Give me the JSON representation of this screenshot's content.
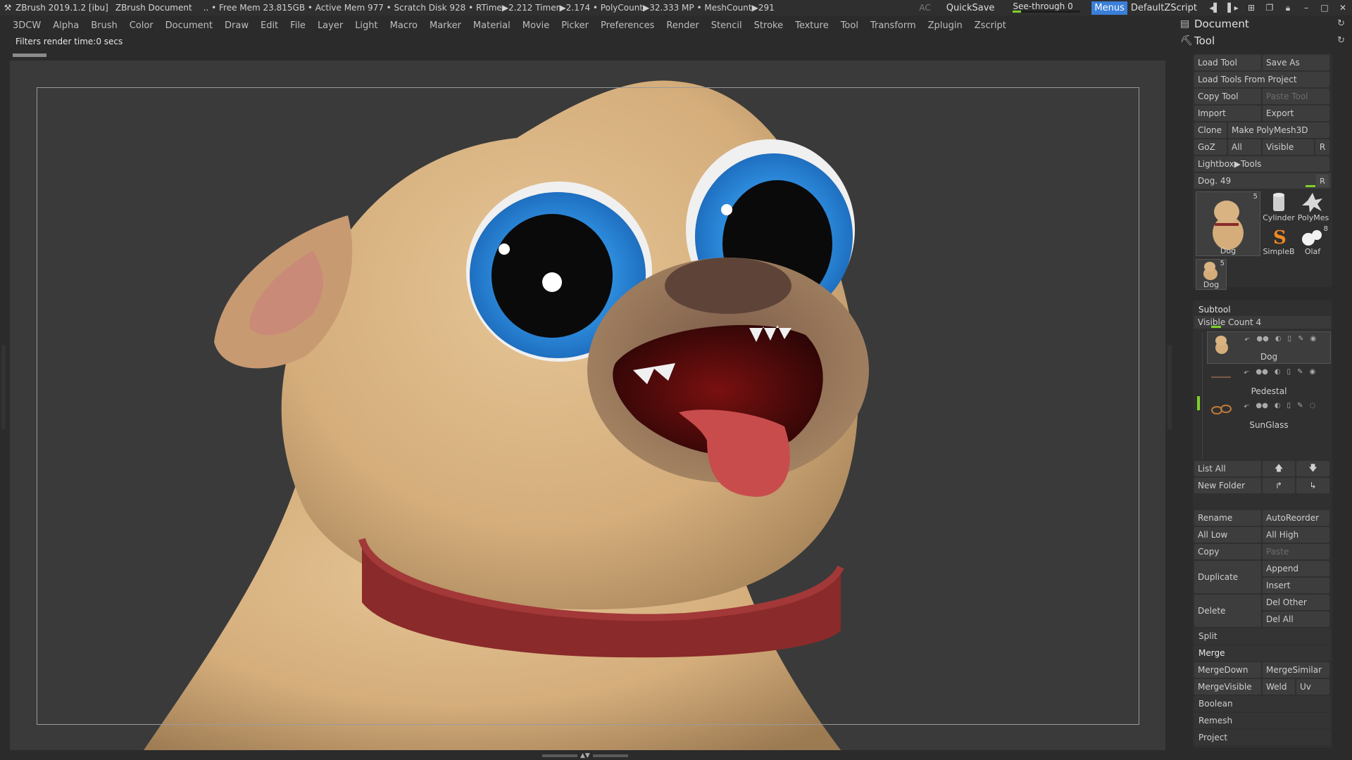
{
  "titlebar": {
    "app": "ZBrush 2019.1.2 [ibu]",
    "document": "ZBrush Document",
    "stats": ".. • Free Mem 23.815GB • Active Mem 977 • Scratch Disk 928 •  RTime▶2.212 Timer▶2.174 • PolyCount▶32.333 MP  • MeshCount▶291",
    "ac": "AC",
    "quicksave": "QuickSave",
    "see_through_label": "See-through  0",
    "see_through_value": 0,
    "menus": "Menus",
    "default_zscript": "DefaultZScript"
  },
  "menubar": [
    "3DCW",
    "Alpha",
    "Brush",
    "Color",
    "Document",
    "Draw",
    "Edit",
    "File",
    "Layer",
    "Light",
    "Macro",
    "Marker",
    "Material",
    "Movie",
    "Picker",
    "Preferences",
    "Render",
    "Stencil",
    "Stroke",
    "Texture",
    "Tool",
    "Transform",
    "Zplugin",
    "Zscript"
  ],
  "status_note": "Filters render time:0 secs",
  "palette": {
    "document_label": "Document",
    "tool_label": "Tool",
    "tool": {
      "load_tool": "Load Tool",
      "save_as": "Save As",
      "load_from_project": "Load Tools From Project",
      "copy_tool": "Copy Tool",
      "paste_tool": "Paste Tool",
      "import": "Import",
      "export": "Export",
      "clone": "Clone",
      "make_polymesh": "Make PolyMesh3D",
      "goz": "GoZ",
      "all": "All",
      "visible": "Visible",
      "r": "R",
      "lightbox": "Lightbox▶Tools",
      "current_tool": "Dog. 49",
      "thumbs": [
        {
          "name": "Dog",
          "count": "5"
        },
        {
          "name": "Cylinder",
          "count": ""
        },
        {
          "name": "PolyMes",
          "count": ""
        },
        {
          "name": "SimpleB",
          "count": ""
        },
        {
          "name": "Olaf",
          "count": "8"
        },
        {
          "name": "Dog",
          "count": "5"
        }
      ]
    },
    "subtool": {
      "title": "Subtool",
      "visible_count": "Visible Count 4",
      "items": [
        {
          "name": "Dog"
        },
        {
          "name": "Pedestal"
        },
        {
          "name": "SunGlass"
        }
      ],
      "list_all": "List All",
      "new_folder": "New Folder",
      "rename": "Rename",
      "auto_reorder": "AutoReorder",
      "all_low": "All Low",
      "all_high": "All High",
      "copy": "Copy",
      "paste": "Paste",
      "duplicate": "Duplicate",
      "append": "Append",
      "insert": "Insert",
      "delete": "Delete",
      "del_other": "Del Other",
      "del_all": "Del All",
      "split": "Split",
      "merge": "Merge",
      "merge_down": "MergeDown",
      "merge_similar": "MergeSimilar",
      "merge_visible": "MergeVisible",
      "weld": "Weld",
      "uv": "Uv",
      "boolean": "Boolean",
      "remesh": "Remesh",
      "project": "Project"
    }
  }
}
